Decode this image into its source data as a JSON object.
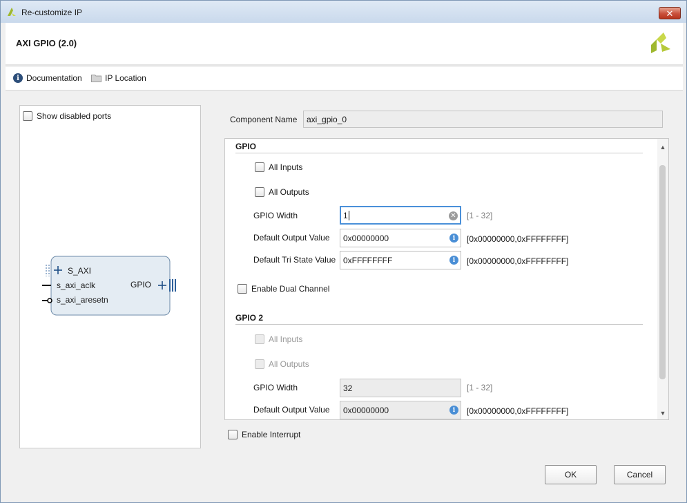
{
  "window": {
    "title": "Re-customize IP",
    "close_label": "✕"
  },
  "header": {
    "title": "AXI GPIO (2.0)"
  },
  "toolbar": {
    "documentation_label": "Documentation",
    "ip_location_label": "IP Location"
  },
  "left_panel": {
    "show_disabled_ports_label": "Show disabled ports",
    "symbol": {
      "ports_left": [
        "S_AXI",
        "s_axi_aclk",
        "s_axi_aresetn"
      ],
      "port_right": "GPIO"
    }
  },
  "component": {
    "label": "Component Name",
    "value": "axi_gpio_0"
  },
  "gpio": {
    "section_title": "GPIO",
    "all_inputs_label": "All Inputs",
    "all_outputs_label": "All Outputs",
    "width_label": "GPIO Width",
    "width_value": "1",
    "width_range": "[1 - 32]",
    "default_output_label": "Default Output Value",
    "default_output_value": "0x00000000",
    "default_output_range": "[0x00000000,0xFFFFFFFF]",
    "default_tri_label": "Default Tri State Value",
    "default_tri_value": "0xFFFFFFFF",
    "default_tri_range": "[0x00000000,0xFFFFFFFF]"
  },
  "dual_channel_label": "Enable Dual Channel",
  "gpio2": {
    "section_title": "GPIO 2",
    "all_inputs_label": "All Inputs",
    "all_outputs_label": "All Outputs",
    "width_label": "GPIO Width",
    "width_value": "32",
    "width_range": "[1 - 32]",
    "default_output_label": "Default Output Value",
    "default_output_value": "0x00000000",
    "default_output_range": "[0x00000000,0xFFFFFFFF]"
  },
  "enable_interrupt_label": "Enable Interrupt",
  "buttons": {
    "ok": "OK",
    "cancel": "Cancel"
  },
  "icons": {
    "title_logo": "xilinx-logo-icon",
    "brand_logo": "xilinx-logo-icon",
    "documentation": "info-icon",
    "ip_location": "folder-icon"
  },
  "colors": {
    "brand_green": "#9fb82e",
    "focus_blue": "#4a90d9",
    "info_blue": "#4a8fd6"
  }
}
